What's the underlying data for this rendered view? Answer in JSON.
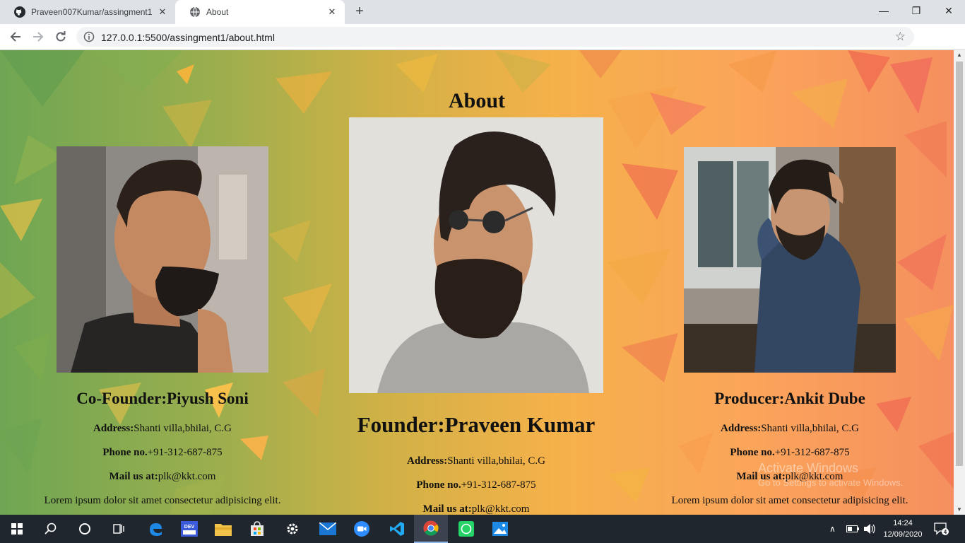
{
  "browser": {
    "tabs": [
      {
        "label": "Praveen007Kumar/assingment1",
        "icon": "github-icon"
      },
      {
        "label": "About",
        "icon": "globe-icon"
      }
    ],
    "url": "127.0.0.1:5500/assingment1/about.html"
  },
  "page": {
    "title": "About",
    "people": [
      {
        "role_title": "Co-Founder:Piyush Soni",
        "address_label": "Address:",
        "address": "Shanti villa,bhilai, C.G",
        "phone_label": "Phone no.",
        "phone": "+91-312-687-875",
        "mail_label": "Mail us at:",
        "mail": "plk@kkt.com",
        "bio": "Lorem ipsum dolor sit amet consectetur adipisicing elit."
      },
      {
        "role_title": "Founder:Praveen Kumar",
        "address_label": "Address:",
        "address": "Shanti villa,bhilai, C.G",
        "phone_label": "Phone no.",
        "phone": "+91-312-687-875",
        "mail_label": "Mail us at:",
        "mail": "plk@kkt.com"
      },
      {
        "role_title": "Producer:Ankit Dube",
        "address_label": "Address:",
        "address": "Shanti villa,bhilai, C.G",
        "phone_label": "Phone no.",
        "phone": "+91-312-687-875",
        "mail_label": "Mail us at:",
        "mail": "plk@kkt.com",
        "bio": "Lorem ipsum dolor sit amet consectetur adipisicing elit."
      }
    ]
  },
  "watermark": {
    "line1": "Activate Windows",
    "line2": "Go to Settings to activate Windows."
  },
  "taskbar": {
    "apps": [
      "start-icon",
      "search-icon",
      "cortana-icon",
      "task-view-icon",
      "edge-icon",
      "dev-icon",
      "file-explorer-icon",
      "store-icon",
      "settings-icon",
      "mail-icon",
      "zoom-icon",
      "vscode-icon",
      "chrome-icon",
      "whatsapp-icon",
      "photos-icon"
    ],
    "time": "14:24",
    "date": "12/09/2020",
    "notifications": "4"
  }
}
